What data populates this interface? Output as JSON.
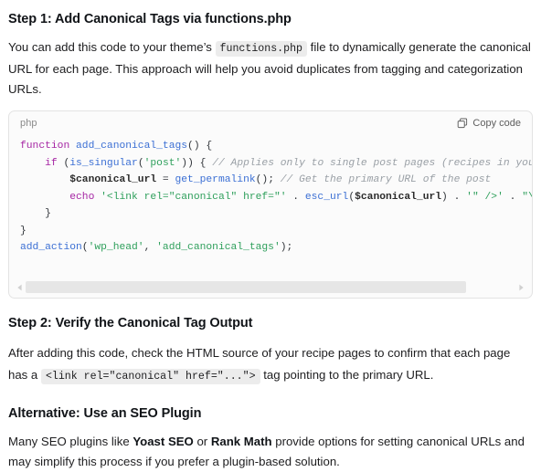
{
  "step1": {
    "heading": "Step 1: Add Canonical Tags via functions.php",
    "paragraph_part1": "You can add this code to your theme’s",
    "inline_code": "functions.php",
    "paragraph_part2": "file to dynamically generate the canonical URL for each page. This approach will help you avoid duplicates from tagging and categorization URLs."
  },
  "code_block": {
    "language_label": "php",
    "copy_label": "Copy code",
    "copy_icon": "copy-icon",
    "lines": [
      [
        {
          "t": "function ",
          "c": "tok-kw"
        },
        {
          "t": "add_canonical_tags",
          "c": "tok-fn"
        },
        {
          "t": "() {",
          "c": "tok-pun"
        }
      ],
      [
        {
          "t": "    ",
          "c": "tok-pun"
        },
        {
          "t": "if",
          "c": "tok-kw"
        },
        {
          "t": " (",
          "c": "tok-pun"
        },
        {
          "t": "is_singular",
          "c": "tok-fn"
        },
        {
          "t": "(",
          "c": "tok-pun"
        },
        {
          "t": "'post'",
          "c": "tok-str"
        },
        {
          "t": ")) { ",
          "c": "tok-pun"
        },
        {
          "t": "// Applies only to single post pages (recipes in your case)",
          "c": "tok-cmt"
        }
      ],
      [
        {
          "t": "        ",
          "c": "tok-pun"
        },
        {
          "t": "$canonical_url",
          "c": "tok-var"
        },
        {
          "t": " = ",
          "c": "tok-pun"
        },
        {
          "t": "get_permalink",
          "c": "tok-fn"
        },
        {
          "t": "(); ",
          "c": "tok-pun"
        },
        {
          "t": "// Get the primary URL of the post",
          "c": "tok-cmt"
        }
      ],
      [
        {
          "t": "        ",
          "c": "tok-pun"
        },
        {
          "t": "echo",
          "c": "tok-kw"
        },
        {
          "t": " ",
          "c": "tok-pun"
        },
        {
          "t": "'<link rel=\"canonical\" href=\"'",
          "c": "tok-str"
        },
        {
          "t": " . ",
          "c": "tok-pun"
        },
        {
          "t": "esc_url",
          "c": "tok-fn"
        },
        {
          "t": "(",
          "c": "tok-pun"
        },
        {
          "t": "$canonical_url",
          "c": "tok-var"
        },
        {
          "t": ") . ",
          "c": "tok-pun"
        },
        {
          "t": "'\" />'",
          "c": "tok-str"
        },
        {
          "t": " . ",
          "c": "tok-pun"
        },
        {
          "t": "\"\\n\"",
          "c": "tok-str"
        },
        {
          "t": ";",
          "c": "tok-pun"
        }
      ],
      [
        {
          "t": "    }",
          "c": "tok-pun"
        }
      ],
      [
        {
          "t": "}",
          "c": "tok-pun"
        }
      ],
      [
        {
          "t": "add_action",
          "c": "tok-fn"
        },
        {
          "t": "(",
          "c": "tok-pun"
        },
        {
          "t": "'wp_head'",
          "c": "tok-str"
        },
        {
          "t": ", ",
          "c": "tok-pun"
        },
        {
          "t": "'add_canonical_tags'",
          "c": "tok-str"
        },
        {
          "t": ");",
          "c": "tok-pun"
        }
      ]
    ],
    "scrollbar": {
      "left_arrow_icon": "chevron-left-icon",
      "right_arrow_icon": "chevron-right-icon",
      "thumb_width_percent": "90"
    }
  },
  "step2": {
    "heading": "Step 2: Verify the Canonical Tag Output",
    "paragraph_part1": "After adding this code, check the HTML source of your recipe pages to confirm that each page has a",
    "inline_code": "<link rel=\"canonical\" href=\"...\">",
    "paragraph_part2": "tag pointing to the primary URL."
  },
  "alternative": {
    "heading": "Alternative: Use an SEO Plugin",
    "paragraph_part1": "Many SEO plugins like",
    "bold_term1": "Yoast SEO",
    "paragraph_part2": "or",
    "bold_term2": "Rank Math",
    "paragraph_part3": "provide options for setting canonical URLs and may simplify this process if you prefer a plugin-based solution."
  },
  "colors": {
    "page_background": "#ffffff",
    "text": "#1d1d1f",
    "heading": "#111418",
    "code_block_background": "#fbfbfb",
    "code_block_border": "#e3e3e3",
    "inline_chip_background": "#ececec",
    "keyword": "#a626a4",
    "function": "#3b6fd4",
    "string": "#2e9f5b",
    "comment": "#9aa0a6",
    "scrollbar_thumb": "#e6e6e6"
  }
}
